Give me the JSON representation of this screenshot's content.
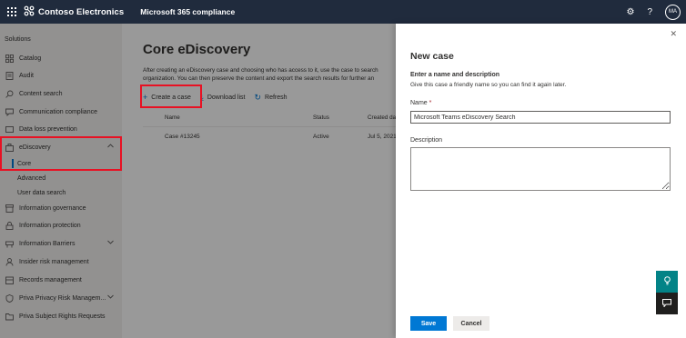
{
  "topbar": {
    "brand": "Contoso Electronics",
    "app": "Microsoft 365 compliance",
    "avatar_initials": "MA",
    "settings_icon": "gear-icon",
    "help_label": "?"
  },
  "sidebar": {
    "section": "Solutions",
    "items": [
      {
        "label": "Catalog",
        "icon": "catalog-icon"
      },
      {
        "label": "Audit",
        "icon": "audit-icon"
      },
      {
        "label": "Content search",
        "icon": "search-icon"
      },
      {
        "label": "Communication compliance",
        "icon": "chat-icon"
      },
      {
        "label": "Data loss prevention",
        "icon": "shield-icon"
      },
      {
        "label": "eDiscovery",
        "icon": "briefcase-icon"
      },
      {
        "label": "Core"
      },
      {
        "label": "Advanced"
      },
      {
        "label": "User data search"
      },
      {
        "label": "Information governance",
        "icon": "archive-icon"
      },
      {
        "label": "Information protection",
        "icon": "lock-icon"
      },
      {
        "label": "Information Barriers",
        "icon": "barrier-icon"
      },
      {
        "label": "Insider risk management",
        "icon": "person-icon"
      },
      {
        "label": "Records management",
        "icon": "records-icon"
      },
      {
        "label": "Priva Privacy Risk Managem...",
        "icon": "privacy-icon"
      },
      {
        "label": "Priva Subject Rights Requests",
        "icon": "folder-icon"
      }
    ]
  },
  "main": {
    "title": "Core eDiscovery",
    "description_line1": "After creating an eDiscovery case and choosing who has access to it, use the case to search",
    "description_line2": "organization. You can then preserve the content and export the search results for further an",
    "commands": {
      "create": "Create a case",
      "download": "Download list",
      "refresh": "Refresh"
    },
    "columns": {
      "name": "Name",
      "status": "Status",
      "created": "Created dat"
    },
    "rows": [
      {
        "name": "Case #13245",
        "status": "Active",
        "created": "Jul 5, 2021 1"
      }
    ]
  },
  "panel": {
    "title": "New case",
    "subtitle": "Enter a name and description",
    "hint": "Give this case a friendly name so you can find it again later.",
    "name_label": "Name",
    "required_mark": "*",
    "name_value": "Microsoft Teams eDiscovery Search",
    "description_label": "Description",
    "description_value": "",
    "save_label": "Save",
    "cancel_label": "Cancel"
  },
  "colors": {
    "topbar": "#202b3d",
    "accent": "#0078d4",
    "highlight": "#e81123",
    "teal": "#038387"
  }
}
